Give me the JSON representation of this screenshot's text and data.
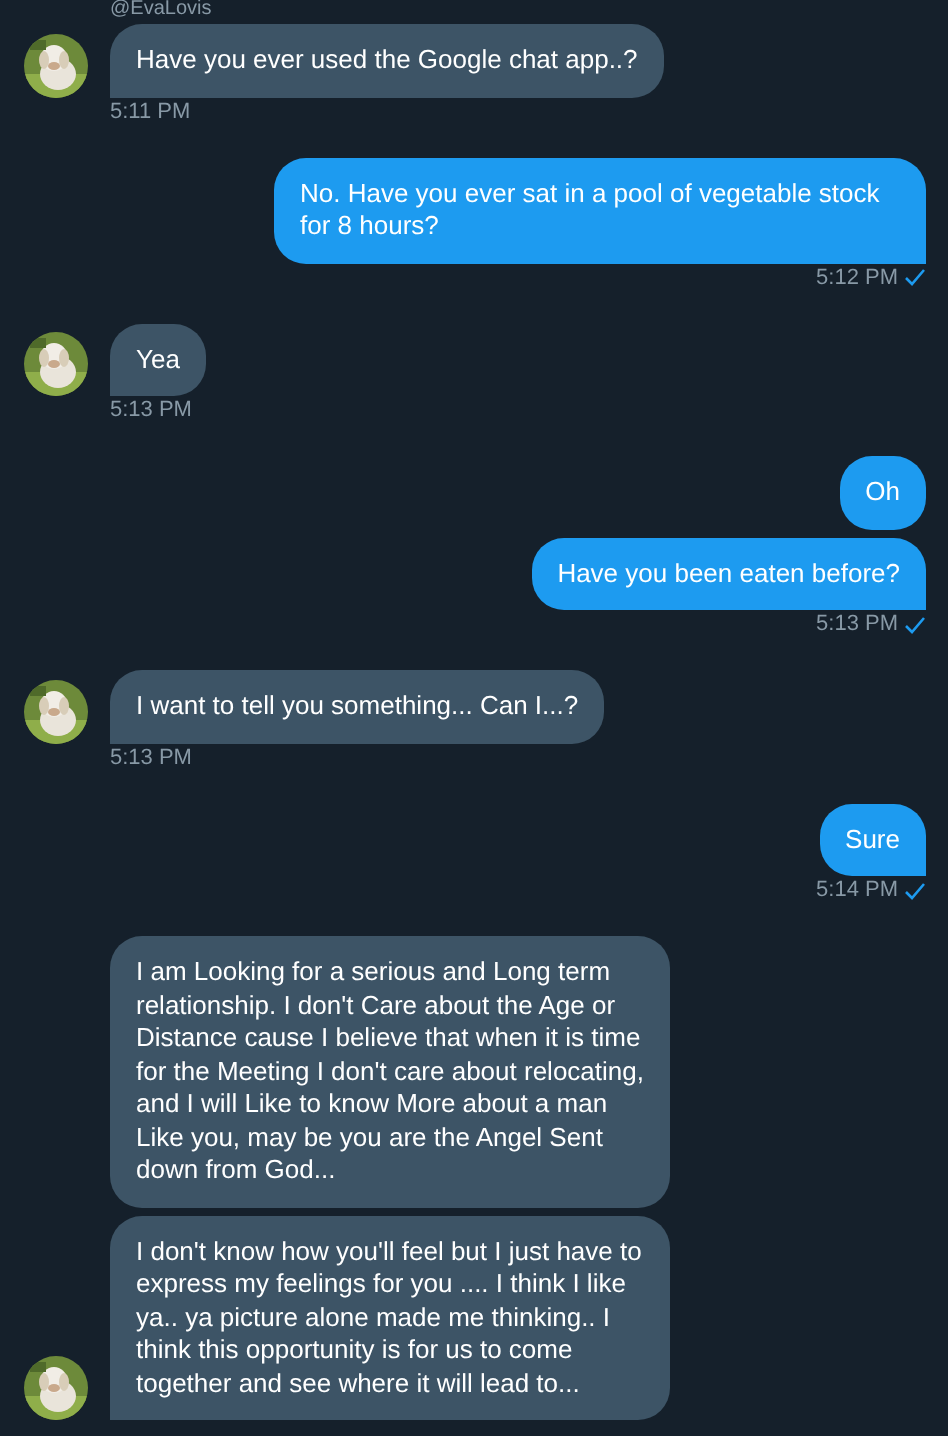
{
  "handle": "@EvaLovis",
  "groups": [
    {
      "kind": "incoming",
      "messages": [
        "Have you ever used the Google chat app..?"
      ],
      "time": "5:11 PM",
      "seen": false
    },
    {
      "kind": "outgoing",
      "messages": [
        "No. Have you ever sat in a pool of vegetable stock for 8 hours?"
      ],
      "time": "5:12 PM",
      "seen": true
    },
    {
      "kind": "incoming",
      "messages": [
        "Yea"
      ],
      "time": "5:13 PM",
      "seen": false
    },
    {
      "kind": "outgoing",
      "messages": [
        "Oh",
        "Have you been eaten before?"
      ],
      "time": "5:13 PM",
      "seen": true
    },
    {
      "kind": "incoming",
      "messages": [
        "I want to tell you something... Can I...?"
      ],
      "time": "5:13 PM",
      "seen": false
    },
    {
      "kind": "outgoing",
      "messages": [
        "Sure"
      ],
      "time": "5:14 PM",
      "seen": true
    },
    {
      "kind": "incoming",
      "messages": [
        "I am Looking for a serious and Long term relationship. I don't Care about the Age or Distance cause I believe that when it is time for the Meeting I don't care about relocating, and I will Like to know More about a man Like you, may be you are the Angel Sent down from God...",
        "I don't know how you'll feel but I just have to express my feelings for you .... I think I like ya.. ya picture alone made me thinking.. I think this opportunity is for us to come together and see where it will lead to..."
      ]
    }
  ]
}
